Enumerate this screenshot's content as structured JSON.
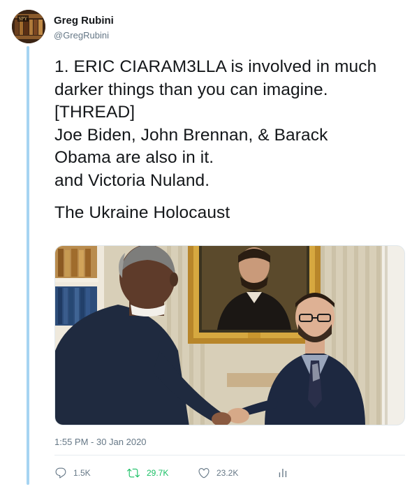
{
  "author": {
    "display_name": "Greg Rubini",
    "handle": "@GregRubini",
    "avatar_text": "SPY"
  },
  "tweet": {
    "lines": [
      "1. ERIC CIARAM3LLA is involved in much",
      "darker things than you can imagine.",
      "[THREAD]",
      "Joe Biden, John Brennan, & Barack",
      "Obama are also in it.",
      "and Victoria Nuland."
    ],
    "closing_line": "The Ukraine Holocaust",
    "timestamp": "1:55 PM - 30 Jan 2020"
  },
  "actions": {
    "reply_count": "1.5K",
    "retweet_count": "29.7K",
    "like_count": "23.2K"
  },
  "colors": {
    "thread_line": "#a6d4f2",
    "retweet_green": "#17bf63",
    "muted_gray": "#657786"
  },
  "icons": [
    "reply-icon",
    "retweet-icon",
    "like-icon",
    "analytics-icon"
  ]
}
